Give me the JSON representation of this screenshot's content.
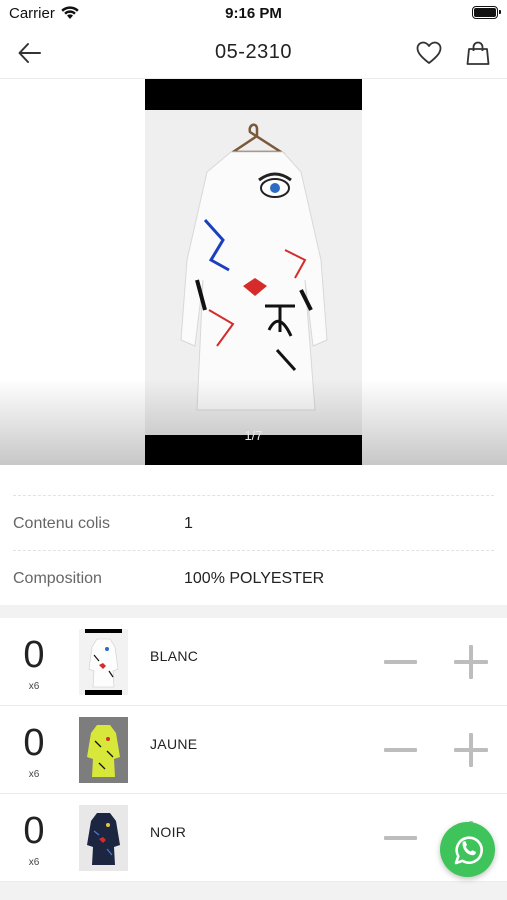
{
  "status_bar": {
    "carrier": "Carrier",
    "time": "9:16 PM"
  },
  "nav": {
    "title": "05-2310",
    "icons": [
      "back-arrow-icon",
      "heart-icon",
      "shopping-bag-icon"
    ]
  },
  "gallery": {
    "counter": "1/7"
  },
  "details": [
    {
      "label": "Contenu colis",
      "value": "1"
    },
    {
      "label": "Composition",
      "value": "100% POLYESTER"
    }
  ],
  "variants": [
    {
      "qty": "0",
      "pack": "x6",
      "name": "BLANC"
    },
    {
      "qty": "0",
      "pack": "x6",
      "name": "JAUNE"
    },
    {
      "qty": "0",
      "pack": "x6",
      "name": "NOIR"
    }
  ],
  "colors": {
    "accent_green": "#3ec45a",
    "stepper_gray": "#bdbdbd"
  }
}
